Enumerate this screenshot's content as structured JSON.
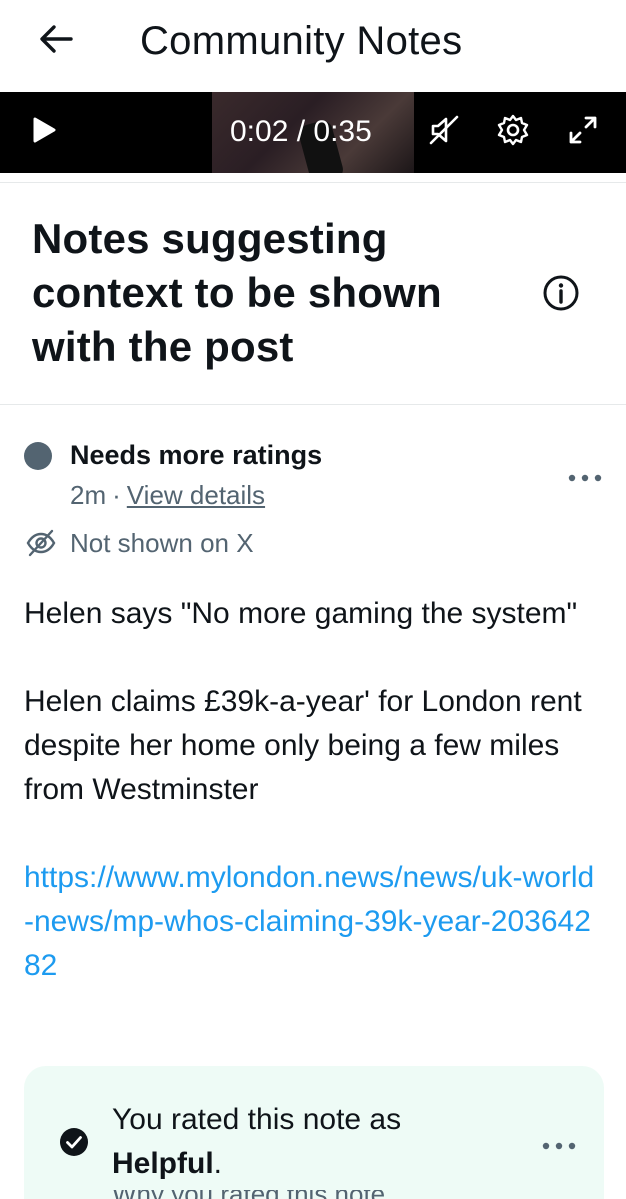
{
  "header": {
    "title": "Community Notes",
    "back_icon": "arrow-left-icon"
  },
  "video": {
    "time": "0:02 / 0:35",
    "icons": [
      "play-icon",
      "muted-speaker-icon",
      "gear-icon",
      "expand-icon"
    ]
  },
  "section": {
    "title": "Notes suggesting context to be shown with the post",
    "info_icon": "info-icon"
  },
  "note": {
    "status": "Needs more ratings",
    "status_color": "#536471",
    "age": "2m",
    "separator": "·",
    "view_details": "View details",
    "not_shown": "Not shown on X",
    "body_paragraph_1": "Helen says \"No more gaming the system\"",
    "body_paragraph_2": "Helen claims £39k-a-year' for London rent despite her home only being a few miles from Westminster",
    "link": "https://www.mylondon.news/news/uk-world-news/mp-whos-claiming-39k-year-20364282",
    "link_color": "#1d9bf0"
  },
  "rating": {
    "prefix": "You rated this note as",
    "value": "Helpful",
    "suffix": ".",
    "cut_off_text": "Why you rated this note as",
    "card_color": "#eefbf6"
  }
}
